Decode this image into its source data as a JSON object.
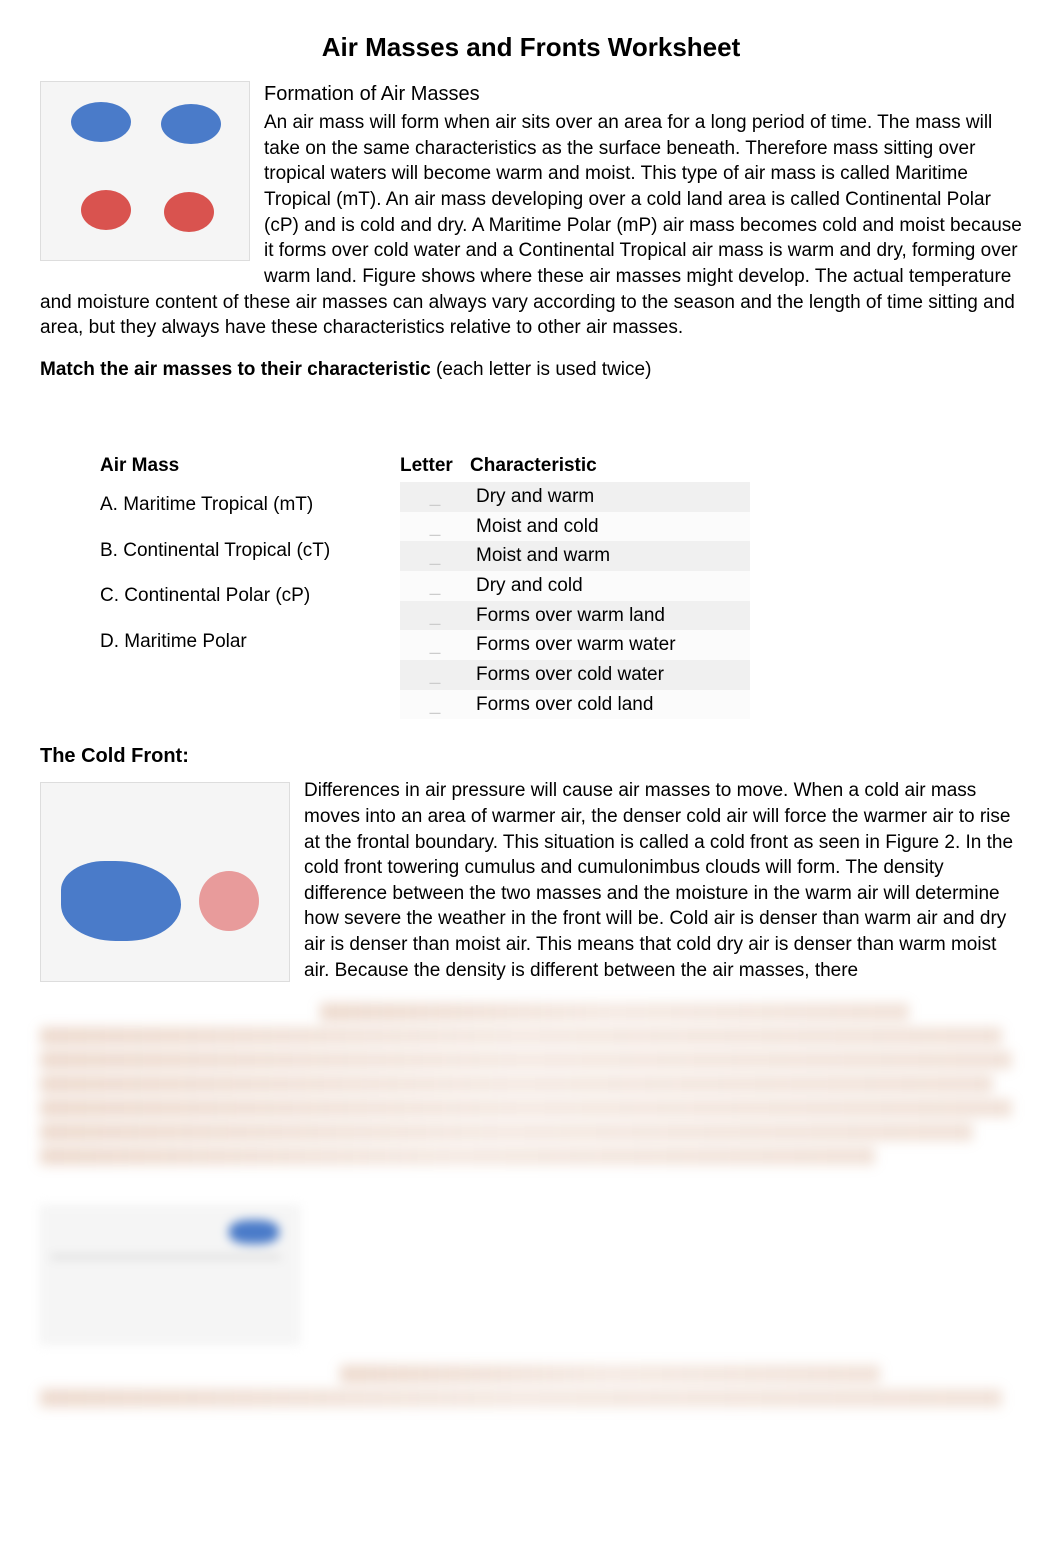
{
  "title": "Air Masses and Fronts Worksheet",
  "section1": {
    "heading": "Formation of Air Masses",
    "body": "An air mass will form when air sits over an area for a long period of time. The mass will take on the same characteristics as the surface beneath. Therefore mass sitting over tropical waters will become warm and moist. This type of air mass is called Maritime Tropical (mT). An air mass developing over a cold land area is called Continental Polar (cP) and is cold and dry. A Maritime Polar (mP) air mass becomes cold and moist because it forms over cold water and a Continental Tropical air mass is warm and dry, forming over warm land. Figure shows where these air masses might develop. The actual temperature and moisture content of these air masses can always vary according to the season and the length of time sitting and area, but they always have these characteristics relative to other air masses."
  },
  "match": {
    "instruction_bold": "Match the air masses to their characteristic",
    "instruction_rest": "(each letter is used twice)",
    "air_mass_header": "Air Mass",
    "letter_header": "Letter",
    "characteristic_header": "Characteristic",
    "air_masses": [
      "A. Maritime Tropical (mT)",
      "B. Continental Tropical (cT)",
      "C. Continental Polar (cP)",
      "D. Maritime Polar"
    ],
    "characteristics": [
      "Dry and warm",
      "Moist and cold",
      "Moist and warm",
      "Dry and cold",
      "Forms over warm land",
      "Forms over warm water",
      "Forms over cold water",
      "Forms over cold land"
    ]
  },
  "cold_front": {
    "heading": "The Cold Front:",
    "body": "Differences in air pressure will cause air masses to move. When a cold air mass moves into an area of warmer air, the denser cold air will force the warmer air to rise at the frontal boundary. This situation is called a cold front as seen in Figure 2. In the cold front towering cumulus and cumulonimbus clouds will form. The density difference between the two masses and the moisture in the warm air will determine how severe the weather in the front will be. Cold air is denser than warm air and dry air is denser than moist air. This means that cold dry air is denser than warm moist air. Because the density is different between the air masses, there"
  }
}
